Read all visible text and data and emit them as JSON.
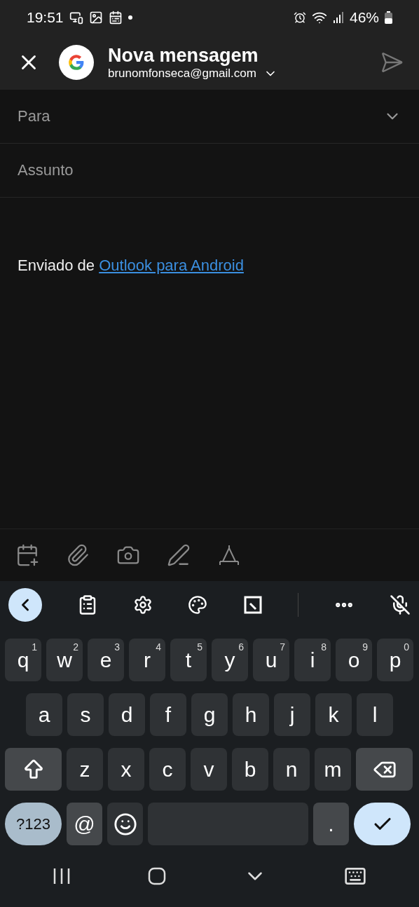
{
  "status_bar": {
    "time": "19:51",
    "battery": "46%"
  },
  "header": {
    "title": "Nova mensagem",
    "account": "brunomfonseca@gmail.com"
  },
  "fields": [
    {
      "placeholder": "Para",
      "expandable": true
    },
    {
      "placeholder": "Assunto",
      "expandable": false
    }
  ],
  "body": {
    "text": "Enviado de ",
    "link": "Outlook para Android"
  },
  "keyboard": {
    "rows": [
      {
        "keys": [
          {
            "kind": "letter",
            "label": "q",
            "hint": "1"
          },
          {
            "kind": "letter",
            "label": "w",
            "hint": "2"
          },
          {
            "kind": "letter",
            "label": "e",
            "hint": "3"
          },
          {
            "kind": "letter",
            "label": "r",
            "hint": "4"
          },
          {
            "kind": "letter",
            "label": "t",
            "hint": "5"
          },
          {
            "kind": "letter",
            "label": "y",
            "hint": "6"
          },
          {
            "kind": "letter",
            "label": "u",
            "hint": "7"
          },
          {
            "kind": "letter",
            "label": "i",
            "hint": "8"
          },
          {
            "kind": "letter",
            "label": "o",
            "hint": "9"
          },
          {
            "kind": "letter",
            "label": "p",
            "hint": "0"
          }
        ]
      },
      {
        "keys": [
          {
            "kind": "letter",
            "label": "a"
          },
          {
            "kind": "letter",
            "label": "s"
          },
          {
            "kind": "letter",
            "label": "d"
          },
          {
            "kind": "letter",
            "label": "f"
          },
          {
            "kind": "letter",
            "label": "g"
          },
          {
            "kind": "letter",
            "label": "h"
          },
          {
            "kind": "letter",
            "label": "j"
          },
          {
            "kind": "letter",
            "label": "k"
          },
          {
            "kind": "letter",
            "label": "l"
          }
        ]
      },
      {
        "keys": [
          {
            "kind": "shift"
          },
          {
            "kind": "letter",
            "label": "z"
          },
          {
            "kind": "letter",
            "label": "x"
          },
          {
            "kind": "letter",
            "label": "c"
          },
          {
            "kind": "letter",
            "label": "v"
          },
          {
            "kind": "letter",
            "label": "b"
          },
          {
            "kind": "letter",
            "label": "n"
          },
          {
            "kind": "letter",
            "label": "m"
          },
          {
            "kind": "backspace"
          }
        ]
      },
      {
        "keys": [
          {
            "kind": "symbols",
            "label": "?123"
          },
          {
            "kind": "char",
            "label": "@"
          },
          {
            "kind": "emoji"
          },
          {
            "kind": "space"
          },
          {
            "kind": "char",
            "label": "."
          },
          {
            "kind": "enter"
          }
        ]
      }
    ]
  }
}
